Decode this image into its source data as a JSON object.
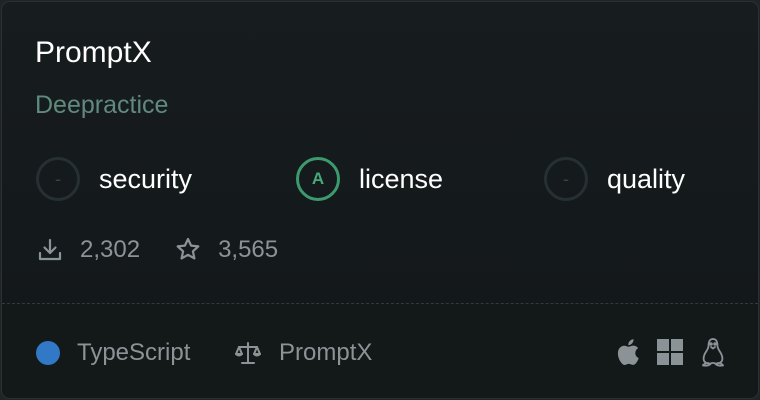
{
  "package": {
    "name": "PromptX",
    "owner": "Deepractice"
  },
  "scores": [
    {
      "label": "security",
      "grade": "-"
    },
    {
      "label": "license",
      "grade": "A"
    },
    {
      "label": "quality",
      "grade": "-"
    }
  ],
  "stats": {
    "downloads": "2,302",
    "stars": "3,565"
  },
  "footer": {
    "language": "TypeScript",
    "language_color": "#3178c6",
    "license": "PromptX",
    "platforms": [
      "apple-icon",
      "windows-icon",
      "linux-icon"
    ]
  },
  "colors": {
    "owner": "#5f8a7d",
    "grade_a": "#3c9a6e"
  }
}
